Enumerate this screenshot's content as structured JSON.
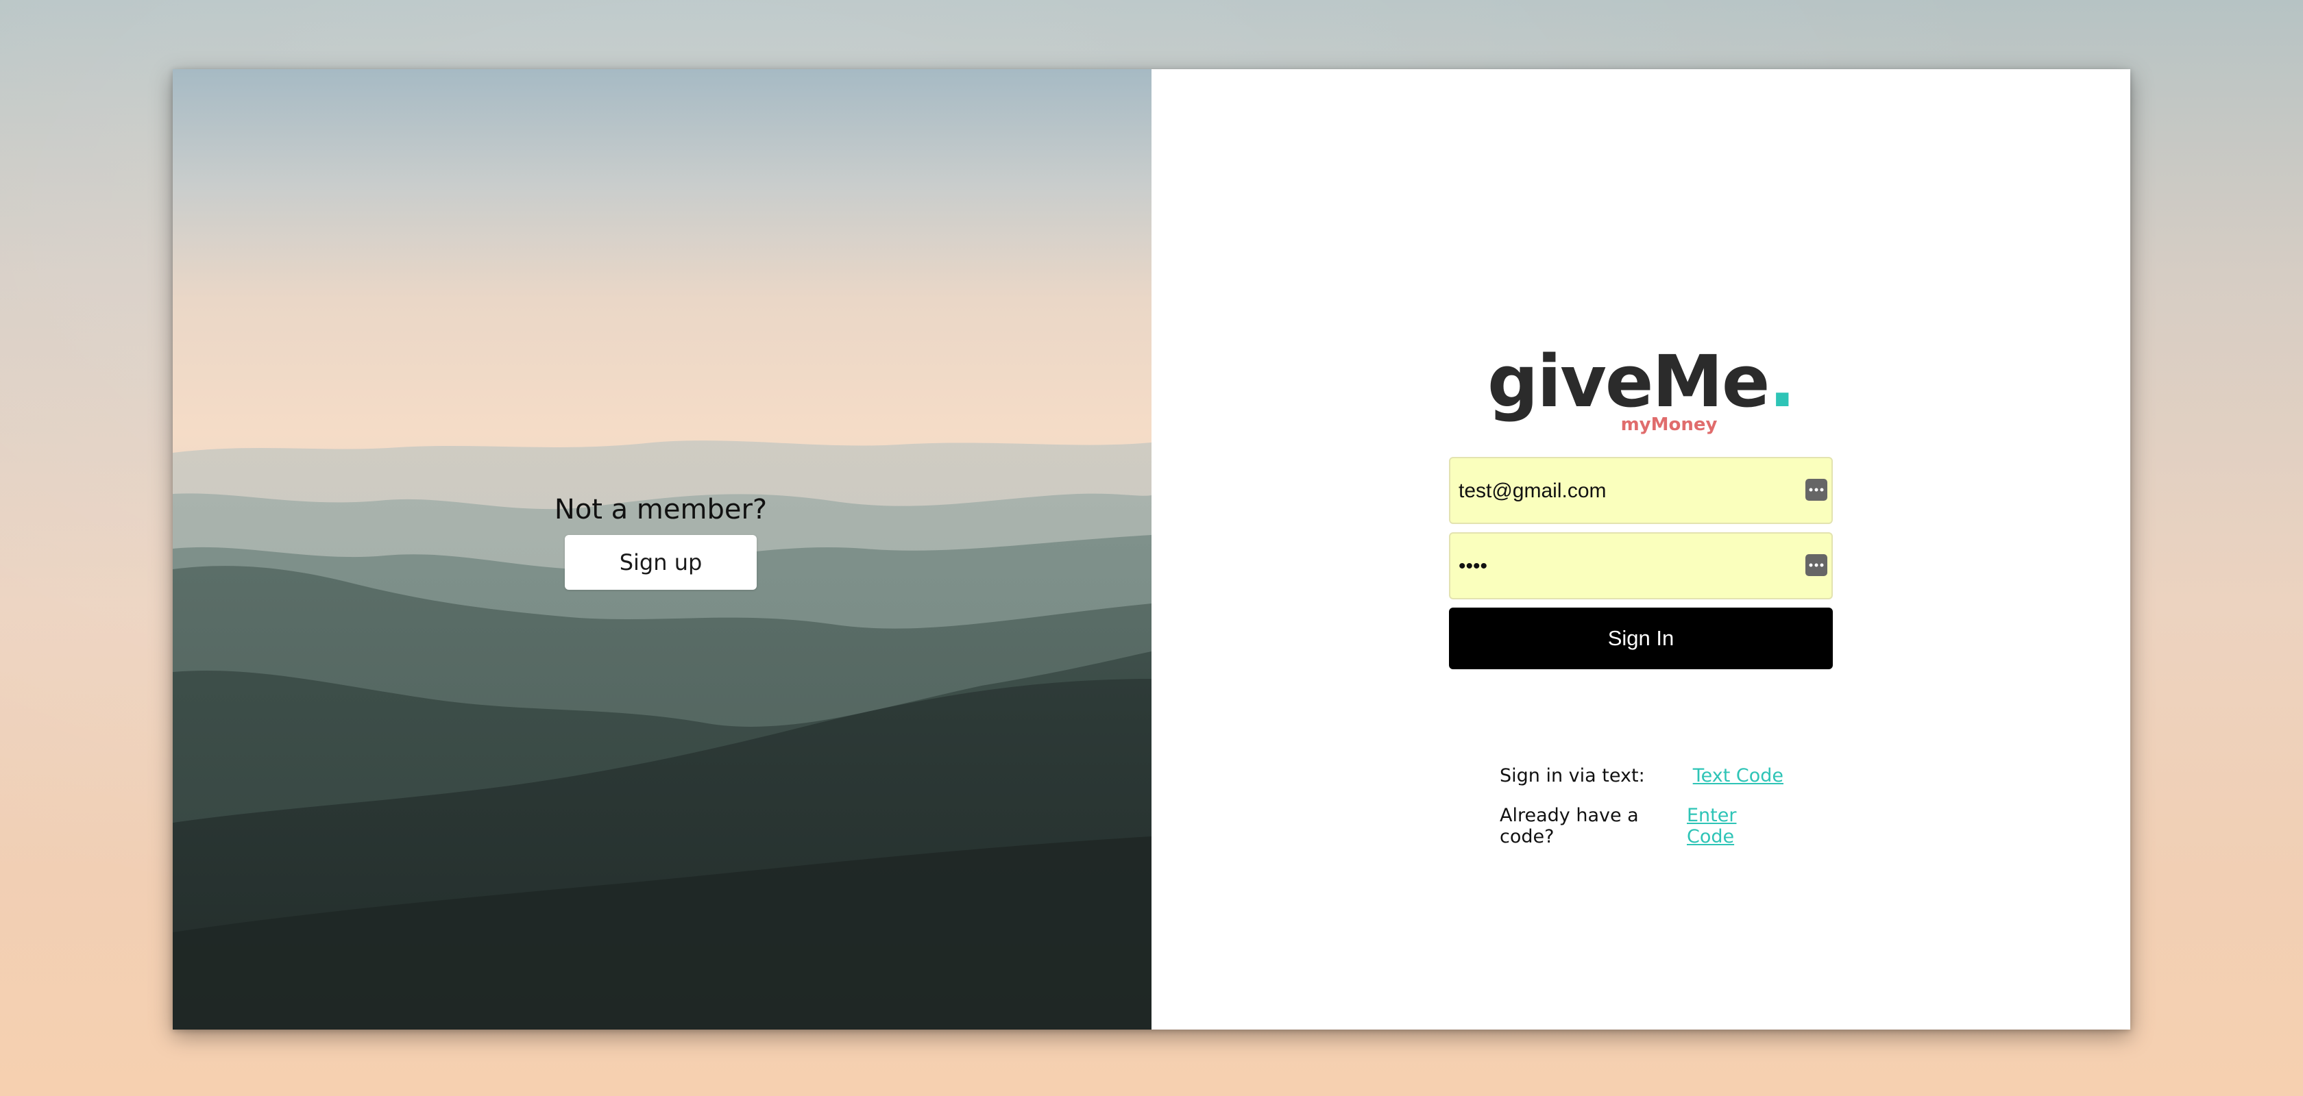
{
  "signup": {
    "prompt": "Not a member?",
    "button_label": "Sign up"
  },
  "logo": {
    "text": "giveMe",
    "dot": ".",
    "subtitle": "myMoney"
  },
  "form": {
    "email_value": "test@gmail.com",
    "password_value": "••••",
    "signin_label": "Sign In"
  },
  "alt": {
    "text_label": "Sign in via text:",
    "text_link": "Text Code",
    "code_label": "Already have a code?",
    "code_link": "Enter Code"
  },
  "colors": {
    "accent": "#2ec4b6",
    "subtitle": "#e06c6c",
    "autofill": "#faffbd"
  },
  "icons": {
    "password_manager": "password-manager-icon"
  }
}
